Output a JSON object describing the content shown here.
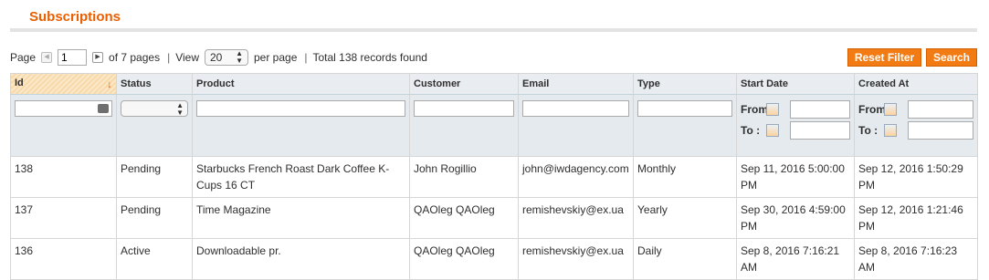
{
  "page": {
    "title": "Subscriptions"
  },
  "pager": {
    "page_label": "Page",
    "page_value": "1",
    "of_pages": "of 7 pages",
    "sep": "|",
    "view_label": "View",
    "per_page_value": "20",
    "per_page_label": "per page",
    "total": "Total 138 records found"
  },
  "buttons": {
    "reset": "Reset Filter",
    "search": "Search"
  },
  "columns": [
    {
      "label": "Id"
    },
    {
      "label": "Status"
    },
    {
      "label": "Product"
    },
    {
      "label": "Customer"
    },
    {
      "label": "Email"
    },
    {
      "label": "Type"
    },
    {
      "label": "Start Date"
    },
    {
      "label": "Created At"
    }
  ],
  "filters": {
    "from_label": "From:",
    "to_label": "To :"
  },
  "rows": [
    {
      "id": "138",
      "status": "Pending",
      "product": "Starbucks French Roast Dark Coffee K-Cups 16 CT",
      "customer": "John Rogillio",
      "email": "john@iwdagency.com",
      "type": "Monthly",
      "start_date": "Sep 11, 2016 5:00:00 PM",
      "created_at": "Sep 12, 2016 1:50:29 PM"
    },
    {
      "id": "137",
      "status": "Pending",
      "product": "Time Magazine",
      "customer": "QAOleg QAOleg",
      "email": "remishevskiy@ex.ua",
      "type": "Yearly",
      "start_date": "Sep 30, 2016 4:59:00 PM",
      "created_at": "Sep 12, 2016 1:21:46 PM"
    },
    {
      "id": "136",
      "status": "Active",
      "product": "Downloadable pr.",
      "customer": "QAOleg QAOleg",
      "email": "remishevskiy@ex.ua",
      "type": "Daily",
      "start_date": "Sep 8, 2016 7:16:21 AM",
      "created_at": "Sep 8, 2016 7:16:23 AM"
    }
  ],
  "colors": {
    "accent": "#eb5e00",
    "button": "#f37b14",
    "header_bg": "#e9edf1"
  }
}
